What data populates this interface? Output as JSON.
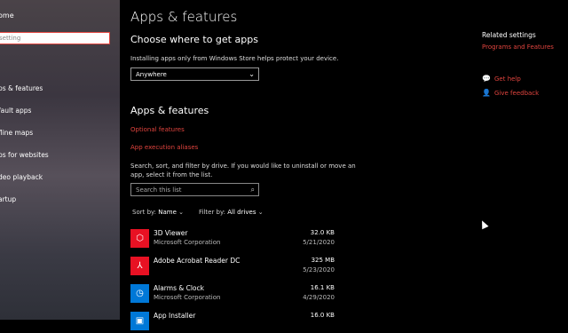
{
  "sidebar": {
    "home": "ome",
    "search_placeholder": "setting",
    "items": [
      {
        "label": "ps & features"
      },
      {
        "label": "fault apps"
      },
      {
        "label": "fline maps"
      },
      {
        "label": "ps for websites"
      },
      {
        "label": "deo playback"
      },
      {
        "label": "artup"
      }
    ]
  },
  "main": {
    "title": "Apps & features",
    "choose_heading": "Choose where to get apps",
    "choose_desc": "Installing apps only from Windows Store helps protect your device.",
    "dropdown_value": "Anywhere",
    "section_heading": "Apps & features",
    "link_optional": "Optional features",
    "link_aliases": "App execution aliases",
    "search_desc_1": "Search, sort, and filter by drive. If you would like to uninstall or move an",
    "search_desc_2": "app, select it from the list.",
    "search_placeholder": "Search this list",
    "sort_label": "Sort by:",
    "sort_value": "Name",
    "filter_label": "Filter by:",
    "filter_value": "All drives",
    "apps": [
      {
        "name": "3D Viewer",
        "publisher": "Microsoft Corporation",
        "size": "32.0 KB",
        "date": "5/21/2020",
        "icon": "cube-icon",
        "color": "#e81123"
      },
      {
        "name": "Adobe Acrobat Reader DC",
        "publisher": "",
        "size": "325 MB",
        "date": "5/23/2020",
        "icon": "pdf-icon",
        "color": "#e81123"
      },
      {
        "name": "Alarms & Clock",
        "publisher": "Microsoft Corporation",
        "size": "16.1 KB",
        "date": "4/29/2020",
        "icon": "clock-icon",
        "color": "#0078d7"
      },
      {
        "name": "App Installer",
        "publisher": "",
        "size": "16.0 KB",
        "date": "",
        "icon": "box-icon",
        "color": "#0078d7"
      }
    ]
  },
  "related": {
    "title": "Related settings",
    "link": "Programs and Features",
    "help": "Get help",
    "feedback": "Give feedback"
  }
}
